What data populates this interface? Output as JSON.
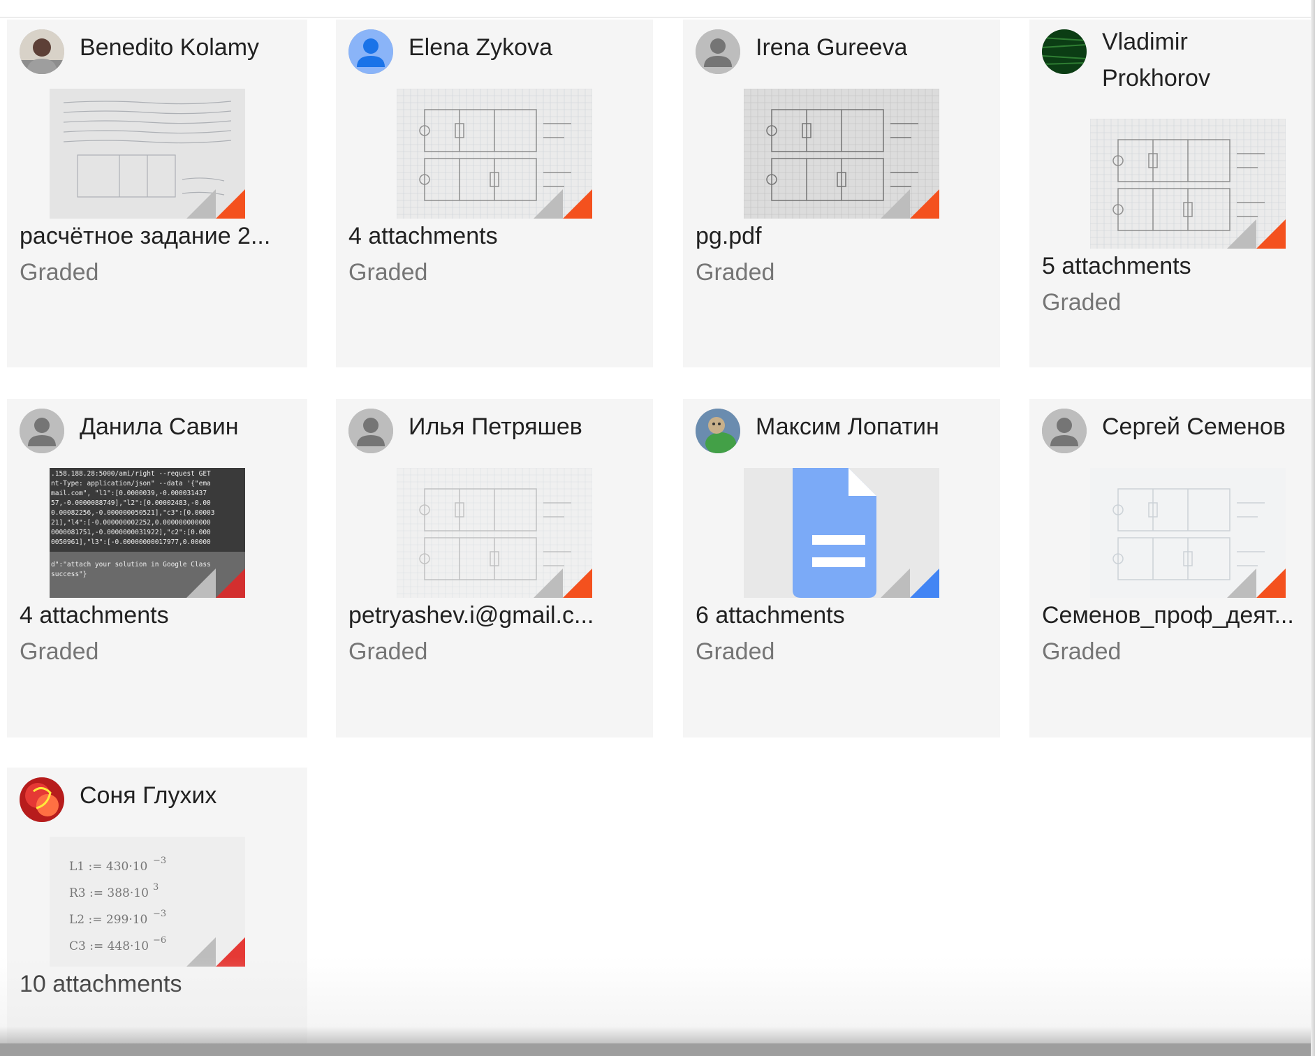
{
  "status_label": "Graded",
  "cards": [
    {
      "name": "Benedito Kolamy",
      "title": "расчётное задание 2...",
      "status": "Graded",
      "avatar": "photo-avatar",
      "thumb": "notebook-sketch",
      "corner": "#f4511e"
    },
    {
      "name": "Elena Zykova",
      "title": "4 attachments",
      "status": "Graded",
      "avatar": "blue-person-avatar",
      "thumb": "circuit-grid",
      "corner": "#f4511e"
    },
    {
      "name": "Irena Gureeva",
      "title": "pg.pdf",
      "status": "Graded",
      "avatar": "grey-person-avatar",
      "thumb": "circuit-grid-dark",
      "corner": "#f4511e"
    },
    {
      "name": "Vladimir Prokhorov",
      "title": "5 attachments",
      "status": "Graded",
      "avatar": "green-photo-avatar",
      "thumb": "circuit-grid",
      "corner": "#f4511e"
    },
    {
      "name": "Данила Савин",
      "title": "4 attachments",
      "status": "Graded",
      "avatar": "grey-person-avatar",
      "thumb": "terminal-screenshot",
      "corner": "#d32f2f"
    },
    {
      "name": "Илья Петряшев",
      "title": "petryashev.i@gmail.c...",
      "status": "Graded",
      "avatar": "grey-person-avatar",
      "thumb": "circuit-grid-light",
      "corner": "#f4511e"
    },
    {
      "name": "Максим Лопатин",
      "title": "6 attachments",
      "status": "Graded",
      "avatar": "cat-photo-avatar",
      "thumb": "google-doc-icon",
      "corner": "#4285f4"
    },
    {
      "name": "Сергей Семенов",
      "title": "Семенов_проф_деят...",
      "status": "Graded",
      "avatar": "grey-person-avatar",
      "thumb": "circuit-light",
      "corner": "#f4511e"
    },
    {
      "name": "Соня Глухих",
      "title": "10 attachments",
      "status": "",
      "avatar": "red-neon-avatar",
      "thumb": "formula-sheet",
      "corner": "#e53935"
    }
  ],
  "formulas": [
    "L1 := 430·10",
    "R3 := 388·10",
    "L2 := 299·10",
    "C3 := 448·10"
  ],
  "formula_exponents": [
    "−3",
    "3",
    "−3",
    "−6"
  ],
  "terminal_lines": [
    ".158.188.28:5000/ami/right --request GET",
    "nt-Type: application/json\" --data '{\"ema",
    "mail.com\", \"l1\":[0.0000039,-0.000031437",
    "57,-0.0000088749],\"l2\":[0.00002483,-0.00",
    "0.00082256,-0.000000050521],\"c3\":[0.00003",
    "21],\"l4\":[-0.000000002252,0.000000000000",
    "0000081751,-0.0000000031922],\"c2\":[0.000",
    "0050961],\"l3\":[-0.00000000017977,0.00000",
    "d\":\"attach your solution in Google Class",
    "success\"}"
  ]
}
